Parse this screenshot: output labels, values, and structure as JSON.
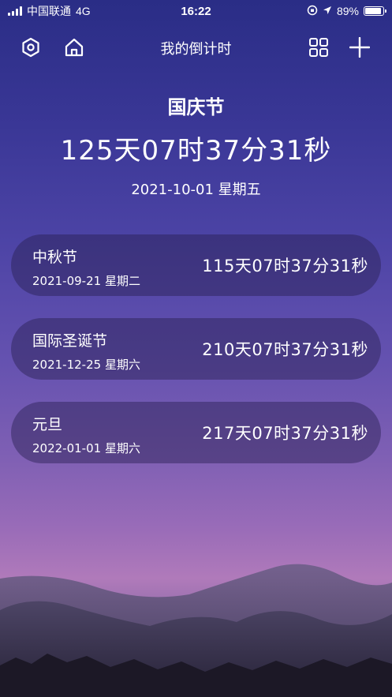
{
  "status_bar": {
    "carrier": "中国联通",
    "network": "4G",
    "time": "16:22",
    "battery": "89%",
    "battery_level": 0.89
  },
  "nav": {
    "title": "我的倒计时",
    "left_icons": [
      "settings-icon",
      "home-icon"
    ],
    "right_icons": [
      "grid-icon",
      "plus-icon"
    ]
  },
  "featured": {
    "name": "国庆节",
    "countdown": "125天07时37分31秒",
    "date": "2021-10-01 星期五"
  },
  "events": [
    {
      "name": "中秋节",
      "date": "2021-09-21 星期二",
      "countdown": "115天07时37分31秒"
    },
    {
      "name": "国际圣诞节",
      "date": "2021-12-25 星期六",
      "countdown": "210天07时37分31秒"
    },
    {
      "name": "元旦",
      "date": "2022-01-01 星期六",
      "countdown": "217天07时37分31秒"
    }
  ]
}
